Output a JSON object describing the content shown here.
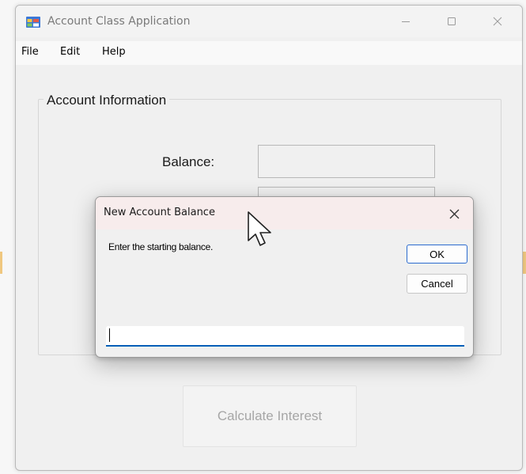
{
  "window": {
    "title": "Account Class Application",
    "controls": [
      "minimize-icon",
      "maximize-icon",
      "close-icon"
    ]
  },
  "menu": {
    "items": [
      {
        "label": "File"
      },
      {
        "label": "Edit"
      },
      {
        "label": "Help"
      }
    ]
  },
  "account_info": {
    "group_title": "Account Information",
    "balance_label": "Balance:",
    "balance_value": ""
  },
  "calculate_button": {
    "label": "Calculate Interest",
    "enabled": false
  },
  "dialog": {
    "title": "New Account Balance",
    "prompt": "Enter the starting balance.",
    "ok_label": "OK",
    "cancel_label": "Cancel",
    "input_value": ""
  },
  "colors": {
    "dialog_titlebar": "#f7ecec",
    "input_underline": "#005fb8",
    "ok_border": "#2b6bcf",
    "disabled_text": "#a6a6a6"
  }
}
